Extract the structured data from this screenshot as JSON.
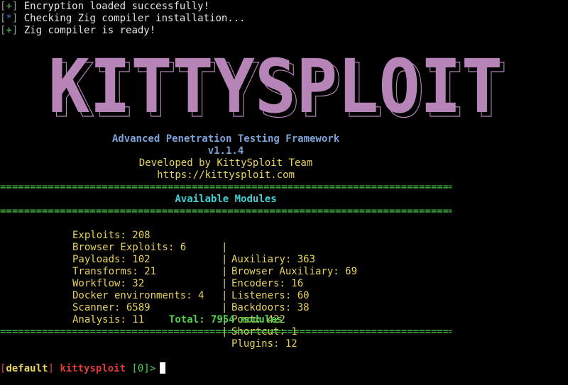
{
  "status_lines": [
    {
      "mark": "+",
      "mark_color": "#4fd34f",
      "text": "Encryption loaded successfully!"
    },
    {
      "mark": "*",
      "mark_color": "#3a78d8",
      "text": "Checking Zig compiler installation..."
    },
    {
      "mark": "+",
      "mark_color": "#4fd34f",
      "text": "Zig compiler is ready!"
    }
  ],
  "banner": {
    "text": "KITTYSPLOIT",
    "color": "#b784b8"
  },
  "info": {
    "framework": "Advanced Penetration Testing Framework",
    "version": "v1.1.4",
    "developer": "Developed by KittySploit Team",
    "url": "https://kittysploit.com"
  },
  "separator": "=========================================================================================",
  "modules": {
    "title": "Available Modules",
    "rows": [
      {
        "left": "Exploits: 208",
        "right": "Auxiliary: 363"
      },
      {
        "left": "Browser Exploits: 6",
        "right": "Browser Auxiliary: 69"
      },
      {
        "left": "Payloads: 102",
        "right": "Encoders: 16"
      },
      {
        "left": "Transforms: 21",
        "right": "Listeners: 60"
      },
      {
        "left": "Workflow: 32",
        "right": "Backdoors: 38"
      },
      {
        "left": "Docker environments: 4",
        "right": "Post: 422"
      },
      {
        "left": "Scanner: 6589",
        "right": "Shortcut: 1"
      },
      {
        "left": "Analysis: 11",
        "right": "Plugins: 12"
      }
    ],
    "column_separator": "|",
    "total": "Total: 7954 modules"
  },
  "prompt": {
    "context": "default",
    "name": "kittysploit",
    "index": "[0]",
    "arrow": ">"
  }
}
